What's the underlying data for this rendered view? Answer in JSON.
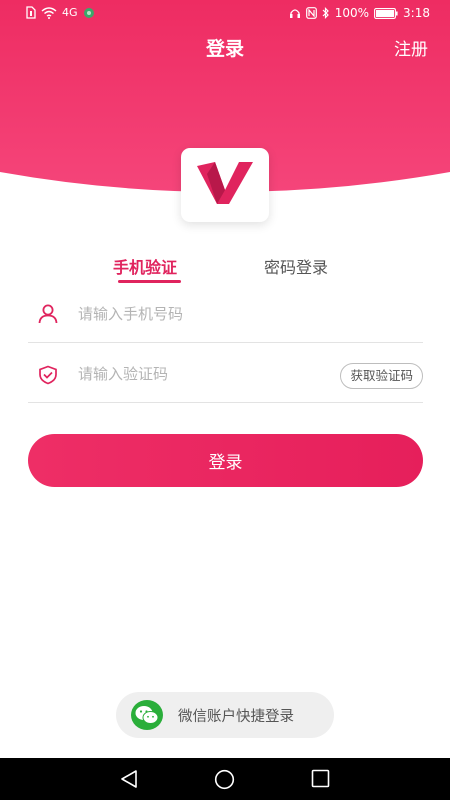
{
  "status_bar": {
    "network_label": "4G",
    "battery_percent": "100%",
    "time": "3:18"
  },
  "colors": {
    "brand": "#e0245e",
    "header_gradient_start": "#f24275",
    "header_gradient_end": "#ec1f5c",
    "wechat_green": "#2aae3a"
  },
  "header": {
    "title": "登录",
    "register_label": "注册"
  },
  "logo": {
    "icon": "v-logo-icon"
  },
  "tabs": [
    {
      "label": "手机验证",
      "active": true
    },
    {
      "label": "密码登录",
      "active": false
    }
  ],
  "form": {
    "phone": {
      "placeholder": "请输入手机号码",
      "value": "",
      "icon": "user-icon"
    },
    "code": {
      "placeholder": "请输入验证码",
      "value": "",
      "icon": "shield-check-icon"
    },
    "get_code_label": "获取验证码",
    "submit_label": "登录"
  },
  "wechat": {
    "label": "微信账户快捷登录",
    "icon": "wechat-icon"
  },
  "system_nav": {
    "back_icon": "back-triangle-icon",
    "home_icon": "home-circle-icon",
    "recent_icon": "recent-square-icon"
  }
}
